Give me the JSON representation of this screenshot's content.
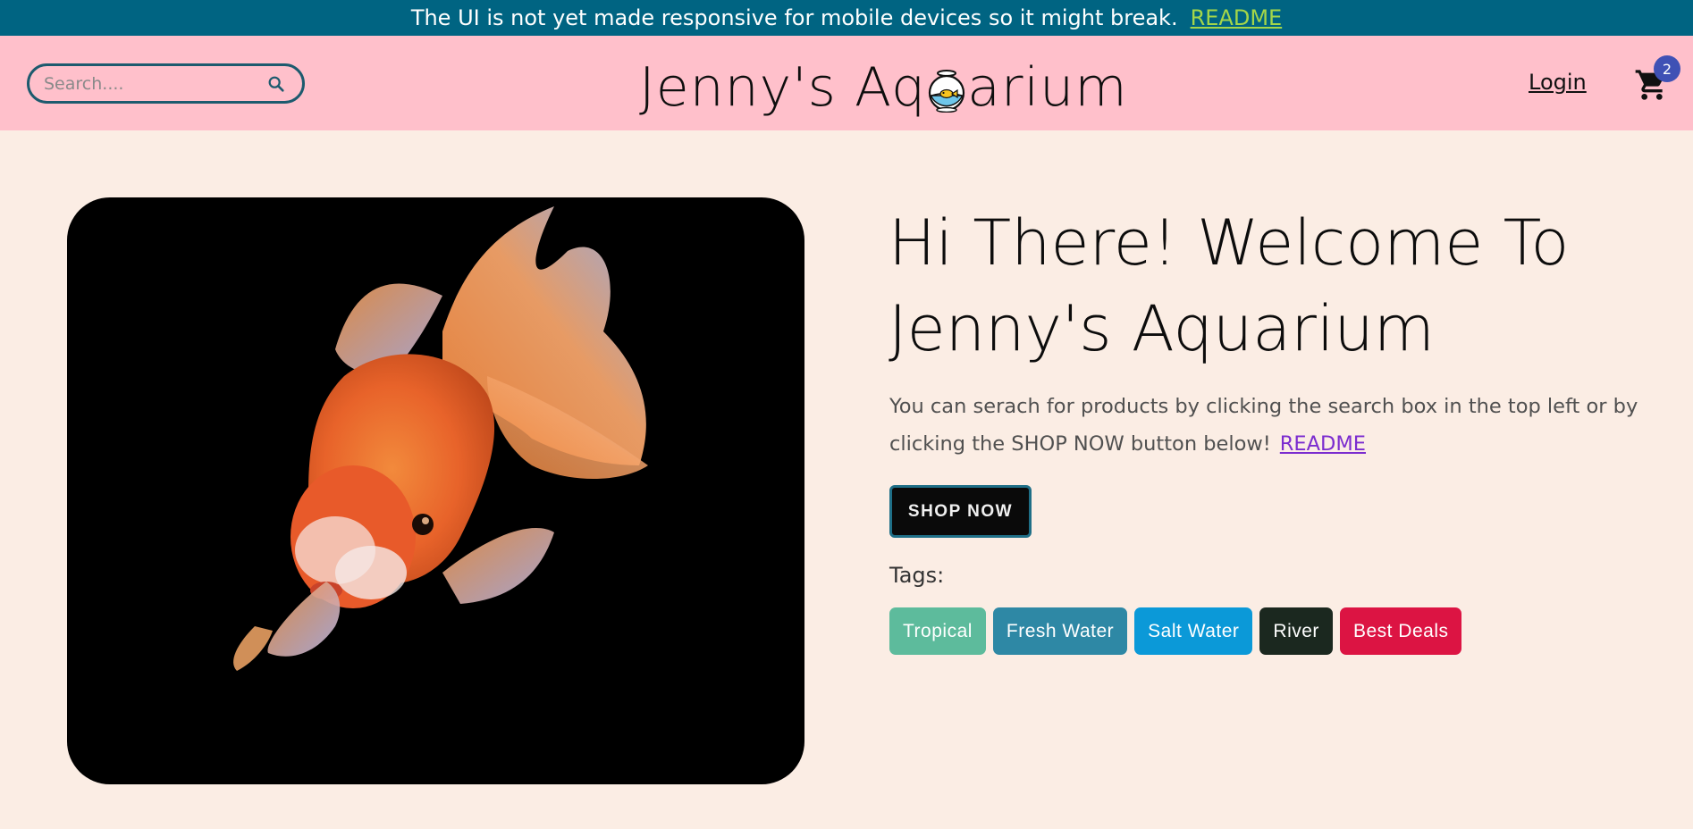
{
  "banner": {
    "message": "The UI is not yet made responsive for mobile devices so it might break.",
    "link_label": "README"
  },
  "header": {
    "search": {
      "placeholder": "Search....",
      "value": "",
      "icon": "search-icon"
    },
    "logo": {
      "text_before": "Jenny's Aq",
      "text_after": "arium",
      "icon": "fishbowl-icon"
    },
    "login_label": "Login",
    "cart": {
      "icon": "cart-icon",
      "count": "2"
    }
  },
  "hero": {
    "image": "goldfish-photo",
    "title": "Hi There! Welcome To Jenny's Aquarium",
    "description": "You can serach for products by clicking the search box in the top left or by clicking the SHOP NOW button below!",
    "readme_label": "README",
    "shop_button_label": "SHOP NOW",
    "tags_label": "Tags:",
    "tags": [
      {
        "label": "Tropical",
        "color": "#5dbb9c"
      },
      {
        "label": "Fresh Water",
        "color": "#2e88a5"
      },
      {
        "label": "Salt Water",
        "color": "#0b99d8"
      },
      {
        "label": "River",
        "color": "#1b281f"
      },
      {
        "label": "Best Deals",
        "color": "#dc1443"
      }
    ]
  },
  "colors": {
    "banner_bg": "#006482",
    "banner_link": "#a4d649",
    "header_bg": "#ffc0cb",
    "page_bg": "#fbede4",
    "accent": "#1f6f87",
    "cart_badge": "#3f51b5",
    "readme_link": "#7b2ccf"
  }
}
